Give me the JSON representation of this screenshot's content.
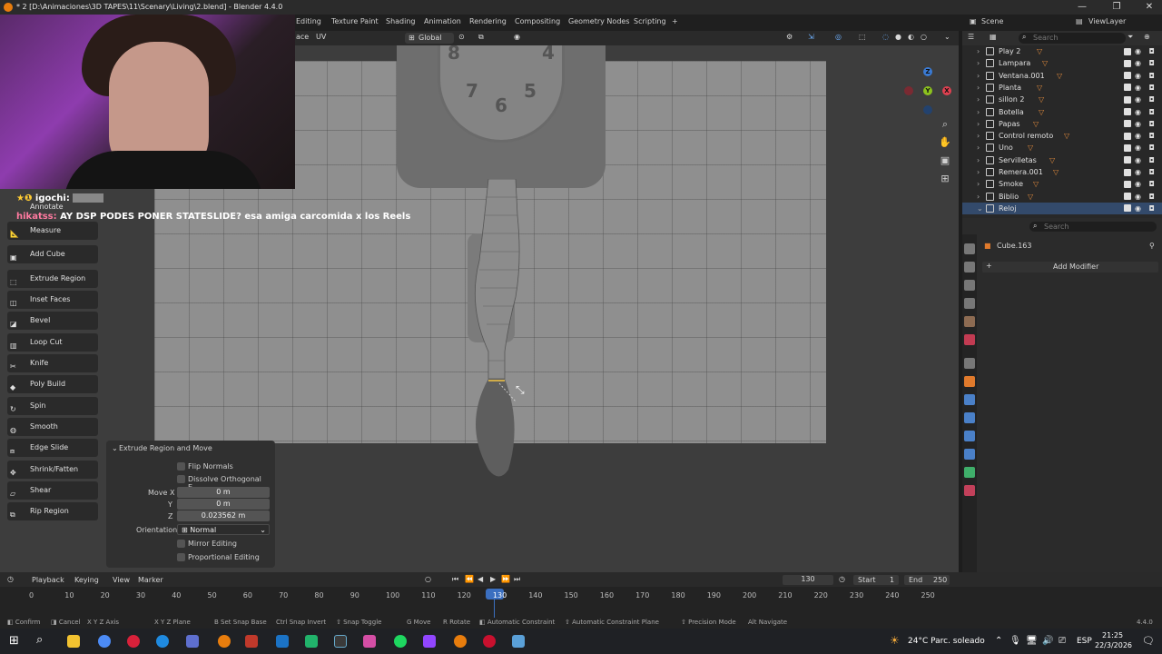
{
  "window": {
    "title": "* 2 [D:\\Animaciones\\3D TAPES\\11\\Scenary\\Living\\2.blend] - Blender 4.4.0",
    "controls": [
      "—",
      "❐",
      "✕"
    ]
  },
  "workspace_tabs": [
    "Editing",
    "Texture Paint",
    "Shading",
    "Animation",
    "Rendering",
    "Compositing",
    "Geometry Nodes",
    "Scripting",
    "+"
  ],
  "scene": {
    "label": "Scene",
    "view_layer": "ViewLayer"
  },
  "viewport_header": {
    "menu_face": "ace",
    "menu_uv": "UV",
    "transform_orientation": "Global"
  },
  "clock_numbers": [
    "8",
    "7",
    "6",
    "5",
    "4"
  ],
  "chat": {
    "line1_user": "igochi:",
    "line2_user": "hikatss:",
    "line2_text": "AY DSP PODES PONER STATESLIDE? esa amiga carcomida x los Reels"
  },
  "toolbar": {
    "items": [
      "Annotate",
      "Measure",
      "Add Cube",
      "Extrude Region",
      "Inset Faces",
      "Bevel",
      "Loop Cut",
      "Knife",
      "Poly Build",
      "Spin",
      "Smooth",
      "Edge Slide",
      "Shrink/Fatten",
      "Shear",
      "Rip Region"
    ]
  },
  "operator_panel": {
    "title": "Extrude Region and Move",
    "flip_normals": "Flip Normals",
    "dissolve_orthogonal": "Dissolve Orthogonal E...",
    "move_x_label": "Move X",
    "move_x": "0 m",
    "y_label": "Y",
    "y": "0 m",
    "z_label": "Z",
    "z": "0.023562 m",
    "orientation_label": "Orientation",
    "orientation": "Normal",
    "mirror_editing": "Mirror Editing",
    "proportional_editing": "Proportional Editing"
  },
  "gizmo": {
    "x": "X",
    "y": "Y",
    "z": "Z"
  },
  "outliner": {
    "search_placeholder": "Search",
    "rows": [
      "Play 2",
      "Lampara",
      "Ventana.001",
      "Planta",
      "sillon 2",
      "Botella",
      "Papas",
      "Control remoto",
      "Uno",
      "Servilletas",
      "Remera.001",
      "Smoke",
      "Biblio",
      "Reloj",
      "Cube.163"
    ]
  },
  "properties": {
    "search_placeholder": "Search",
    "object_name": "Cube.163",
    "add_modifier": "Add Modifier"
  },
  "timeline": {
    "menus": [
      "Playback",
      "Keying",
      "View",
      "Marker"
    ],
    "current_frame": "130",
    "start_label": "Start",
    "start": "1",
    "end_label": "End",
    "end": "250",
    "ruler": [
      "0",
      "10",
      "20",
      "30",
      "40",
      "50",
      "60",
      "70",
      "80",
      "90",
      "100",
      "110",
      "120",
      "130",
      "140",
      "150",
      "160",
      "170",
      "180",
      "190",
      "200",
      "210",
      "220",
      "230",
      "240",
      "250"
    ]
  },
  "statusbar": {
    "items": [
      "Confirm",
      "Cancel",
      "Axis",
      "Plane",
      "Set Snap Base",
      "Snap Invert",
      "Snap Toggle",
      "Move",
      "Rotate",
      "Automatic Constraint",
      "Automatic Constraint Plane",
      "Precision Mode",
      "Navigate"
    ],
    "version": "4.4.0"
  },
  "taskbar": {
    "weather": "24°C  Parc. soleado",
    "lang": "ESP",
    "time": "21:25",
    "date": "22/3/2026"
  }
}
